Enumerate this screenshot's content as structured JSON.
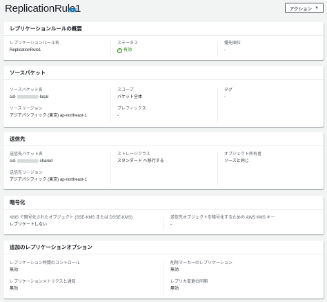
{
  "header": {
    "title": "ReplicationRule1",
    "info": "情報",
    "action_label": "アクション"
  },
  "overview": {
    "title": "レプリケーションルールの概要",
    "rule_name_label": "レプリケーションルール名",
    "rule_name_value": "ReplicationRule1",
    "status_label": "ステータス",
    "status_value": "有効",
    "priority_label": "優先順位",
    "priority_value": "-"
  },
  "source": {
    "title": "ソースバケット",
    "bucket_label": "ソースバケット名",
    "bucket_prefix": "cid-",
    "bucket_suffix": "-local",
    "scope_label": "スコープ",
    "scope_value": "バケット全体",
    "tags_label": "タグ",
    "tags_value": "-",
    "region_label": "ソースリージョン",
    "region_value": "アジアパシフィック (東京) ap-northeast-1",
    "prefix_label": "プレフィックス",
    "prefix_value": "-"
  },
  "destination": {
    "title": "送信先",
    "bucket_label": "送信先バケット名",
    "bucket_prefix": "cid-",
    "bucket_suffix": "-shared",
    "storage_label": "ストレージクラス",
    "storage_value": "スタンダード へ移行する",
    "owner_label": "オブジェクト所有者",
    "owner_value": "ソースと同じ",
    "region_label": "送信先リージョン",
    "region_value": "アジアパシフィック (東京) ap-northeast-1"
  },
  "encryption": {
    "title": "暗号化",
    "kms_label": "KMS で暗号化されたオブジェクト (SSE-KMS または DSSE-KMS)",
    "kms_value": "レプリケートしない",
    "dest_key_label": "送信先オブジェクトを暗号化するための AWS KMS キー",
    "dest_key_value": "-"
  },
  "options": {
    "title": "追加のレプリケーションオプション",
    "rtc_label": "レプリケーション時間のコントロール",
    "rtc_value": "無効",
    "delete_marker_label": "削除マーカーのレプリケーション",
    "delete_marker_value": "無効",
    "metrics_label": "レプリケーションメトリクスと通知",
    "metrics_value": "無効",
    "replica_sync_label": "レプリカ変更の同期",
    "replica_sync_value": "無効"
  },
  "colors": {
    "link": "#0073bb",
    "success": "#1d8102",
    "background": "#f2f3f3"
  }
}
